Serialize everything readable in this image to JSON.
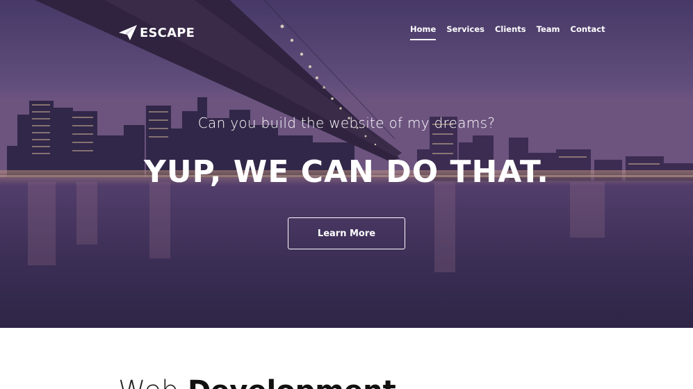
{
  "brand": {
    "name": "ESCAPE",
    "icon": "paper-plane-icon"
  },
  "nav": {
    "items": [
      {
        "label": "Home",
        "active": true
      },
      {
        "label": "Services",
        "active": false
      },
      {
        "label": "Clients",
        "active": false
      },
      {
        "label": "Team",
        "active": false
      },
      {
        "label": "Contact",
        "active": false
      }
    ]
  },
  "hero": {
    "subtitle": "Can you build the website of my dreams?",
    "title": "YUP, WE CAN DO THAT.",
    "button_label": "Learn More"
  },
  "section": {
    "title_light": "Web",
    "title_bold": "Development"
  },
  "colors": {
    "overlay": "#5a4877",
    "text": "#ffffff",
    "page_bg": "#ffffff"
  }
}
